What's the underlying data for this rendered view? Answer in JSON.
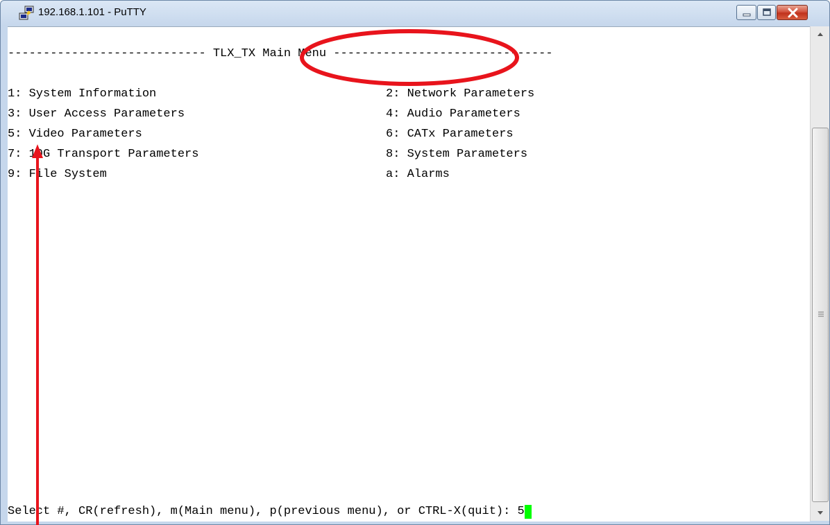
{
  "window": {
    "title": "192.168.1.101 - PuTTY",
    "app_icon": "putty-icon",
    "controls": [
      "minimize-icon",
      "maximize-icon",
      "close-icon"
    ]
  },
  "terminal": {
    "header_left": "---------------------------",
    "header_title": "- TLX_TX Main Menu -",
    "header_right": "------------------------------",
    "menu": [
      {
        "key": "1",
        "label": "1: System Information"
      },
      {
        "key": "2",
        "label": "2: Network Parameters"
      },
      {
        "key": "3",
        "label": "3: User Access Parameters"
      },
      {
        "key": "4",
        "label": "4: Audio Parameters"
      },
      {
        "key": "5",
        "label": "5: Video Parameters"
      },
      {
        "key": "6",
        "label": "6: CATx Parameters"
      },
      {
        "key": "7",
        "label": "7: 10G Transport Parameters"
      },
      {
        "key": "8",
        "label": "8: System Parameters"
      },
      {
        "key": "9",
        "label": "9: File System"
      },
      {
        "key": "a",
        "label": "a: Alarms"
      }
    ],
    "prompt": "Select #, CR(refresh), m(Main menu), p(previous menu), or CTRL-X(quit): ",
    "input_value": "5",
    "cursor_color": "#00ff00"
  },
  "annotations": {
    "highlight_color": "#e8141c",
    "shapes": [
      "ellipse-around-title",
      "arrow-up-to-menu-separator"
    ]
  },
  "colors": {
    "terminal_bg": "#ffffff",
    "terminal_fg": "#000000"
  }
}
